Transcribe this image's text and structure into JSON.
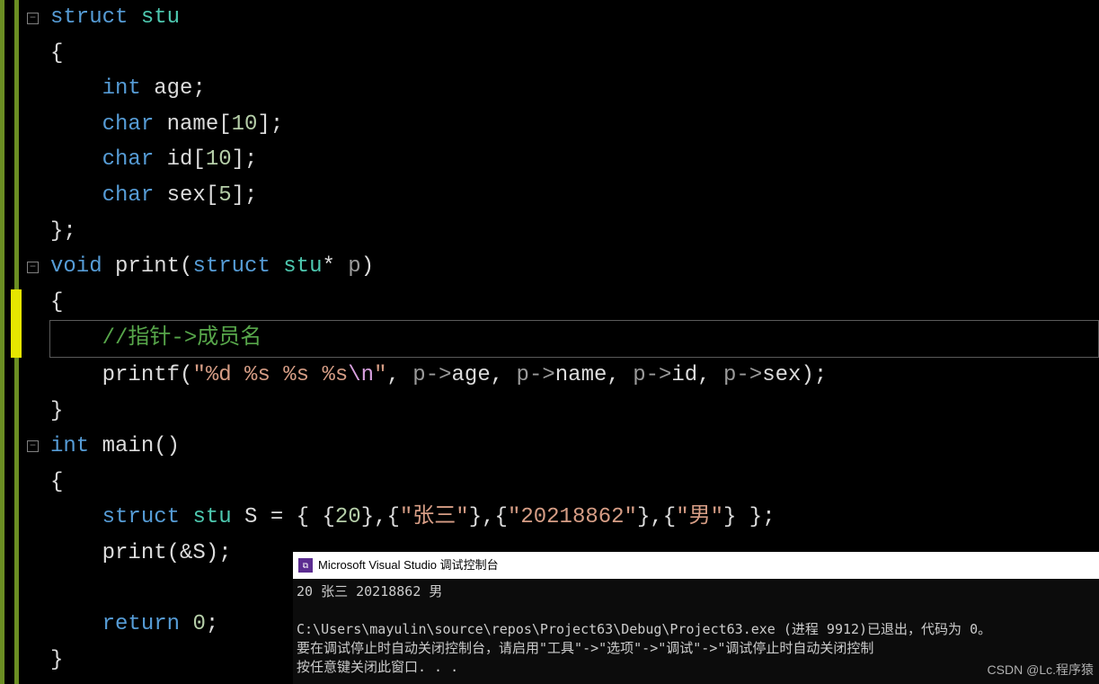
{
  "code": {
    "struct_kw": "struct",
    "struct_name": "stu",
    "open_brace": "{",
    "close_brace_semi": "};",
    "close_brace": "}",
    "int_kw": "int",
    "age_decl": "age;",
    "char_kw": "char",
    "name_decl": "name[",
    "ten": "10",
    "close_arr": "];",
    "id_decl": "id[",
    "sex_decl": "sex[",
    "five": "5",
    "void_kw": "void",
    "print_fn": "print(",
    "print_param_ptr": "* ",
    "param_p": "p",
    "close_paren": ")",
    "comment_arrow": "//指针->成员名",
    "printf_fn": "printf(",
    "fmt_str": "\"%d %s %s %s",
    "escape_n": "\\n",
    "fmt_end": "\"",
    "comma_sp": ", ",
    "p_arrow": "p->",
    "age_m": "age",
    "name_m": "name",
    "id_m": "id",
    "sex_m": "sex",
    "end_call": ");",
    "main_fn": "main()",
    "S_decl_pre": " S = { {",
    "twenty": "20",
    "mid1": "},{",
    "zhangsan": "\"张三\"",
    "mid2": "},{",
    "idstr": "\"20218862\"",
    "mid3": "},{",
    "nan": "\"男\"",
    "tail": "} };",
    "print_call_pre": "print(&S);",
    "return_kw": "return",
    "zero": "0",
    "semi": ";"
  },
  "fold_glyph": "−",
  "console": {
    "title": "Microsoft Visual Studio 调试控制台",
    "output_line": "20 张三 20218862 男",
    "exit_line1": "C:\\Users\\mayulin\\source\\repos\\Project63\\Debug\\Project63.exe (进程 9912)已退出，代码为 0。",
    "exit_line2": "要在调试停止时自动关闭控制台，请启用\"工具\"->\"选项\"->\"调试\"->\"调试停止时自动关闭控制",
    "exit_line3": "按任意键关闭此窗口. . ."
  },
  "watermark": "CSDN @Lc.程序猿"
}
